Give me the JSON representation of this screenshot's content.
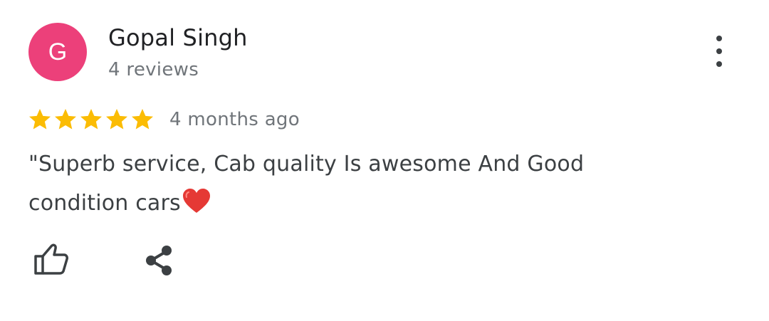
{
  "reviewer": {
    "initial": "G",
    "name": "Gopal Singh",
    "review_count": "4 reviews",
    "avatar_color": "#EC407A"
  },
  "review": {
    "rating": 5,
    "rating_max": 5,
    "date": "4 months ago",
    "text_line1": "\"Superb service, Cab quality Is awesome And Good",
    "text_line2": "condition cars",
    "emoji": "red-heart"
  },
  "colors": {
    "star": "#FBBC04",
    "heart": "#E53935",
    "primary_text": "#202124",
    "secondary_text": "#70757a"
  },
  "actions": {
    "more_icon": "more-vert-icon",
    "like_icon": "thumbs-up-icon",
    "share_icon": "share-icon"
  }
}
